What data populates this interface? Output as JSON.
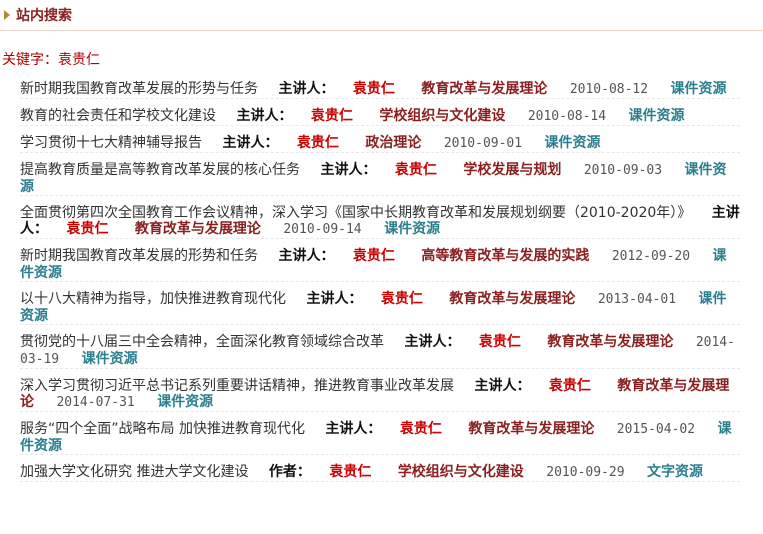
{
  "header": {
    "title": "站内搜索"
  },
  "keyword": "关键字：袁贵仁",
  "results": [
    {
      "title": "新时期我国教育改革发展的形势与任务",
      "label": "主讲人：",
      "speaker": "袁贵仁",
      "category": "教育改革与发展理论",
      "date": "2010-08-12",
      "type": "课件资源"
    },
    {
      "title": "教育的社会责任和学校文化建设",
      "label": "主讲人：",
      "speaker": "袁贵仁",
      "category": "学校组织与文化建设",
      "date": "2010-08-14",
      "type": "课件资源"
    },
    {
      "title": "学习贯彻十七大精神辅导报告",
      "label": "主讲人：",
      "speaker": "袁贵仁",
      "category": "政治理论",
      "date": "2010-09-01",
      "type": "课件资源"
    },
    {
      "title": "提高教育质量是高等教育改革发展的核心任务",
      "label": "主讲人：",
      "speaker": "袁贵仁",
      "category": "学校发展与规划",
      "date": "2010-09-03",
      "type": "课件资源"
    },
    {
      "title": "全面贯彻第四次全国教育工作会议精神，深入学习《国家中长期教育改革和发展规划纲要（2010-2020年）》",
      "label": "主讲人：",
      "speaker": "袁贵仁",
      "category": "教育改革与发展理论",
      "date": "2010-09-14",
      "type": "课件资源"
    },
    {
      "title": "新时期我国教育改革发展的形势和任务",
      "label": "主讲人：",
      "speaker": "袁贵仁",
      "category": "高等教育改革与发展的实践",
      "date": "2012-09-20",
      "type": "课件资源"
    },
    {
      "title": "以十八大精神为指导，加快推进教育现代化",
      "label": "主讲人：",
      "speaker": "袁贵仁",
      "category": "教育改革与发展理论",
      "date": "2013-04-01",
      "type": "课件资源"
    },
    {
      "title": "贯彻党的十八届三中全会精神，全面深化教育领域综合改革",
      "label": "主讲人：",
      "speaker": "袁贵仁",
      "category": "教育改革与发展理论",
      "date": "2014-03-19",
      "type": "课件资源"
    },
    {
      "title": "深入学习贯彻习近平总书记系列重要讲话精神，推进教育事业改革发展",
      "label": "主讲人：",
      "speaker": "袁贵仁",
      "category": "教育改革与发展理论",
      "date": "2014-07-31",
      "type": "课件资源"
    },
    {
      "title": "服务“四个全面”战略布局 加快推进教育现代化",
      "label": "主讲人：",
      "speaker": "袁贵仁",
      "category": "教育改革与发展理论",
      "date": "2015-04-02",
      "type": "课件资源"
    },
    {
      "title": "加强大学文化研究 推进大学文化建设",
      "label": "作者：",
      "speaker": "袁贵仁",
      "category": "学校组织与文化建设",
      "date": "2010-09-29",
      "type": "文字资源"
    }
  ]
}
